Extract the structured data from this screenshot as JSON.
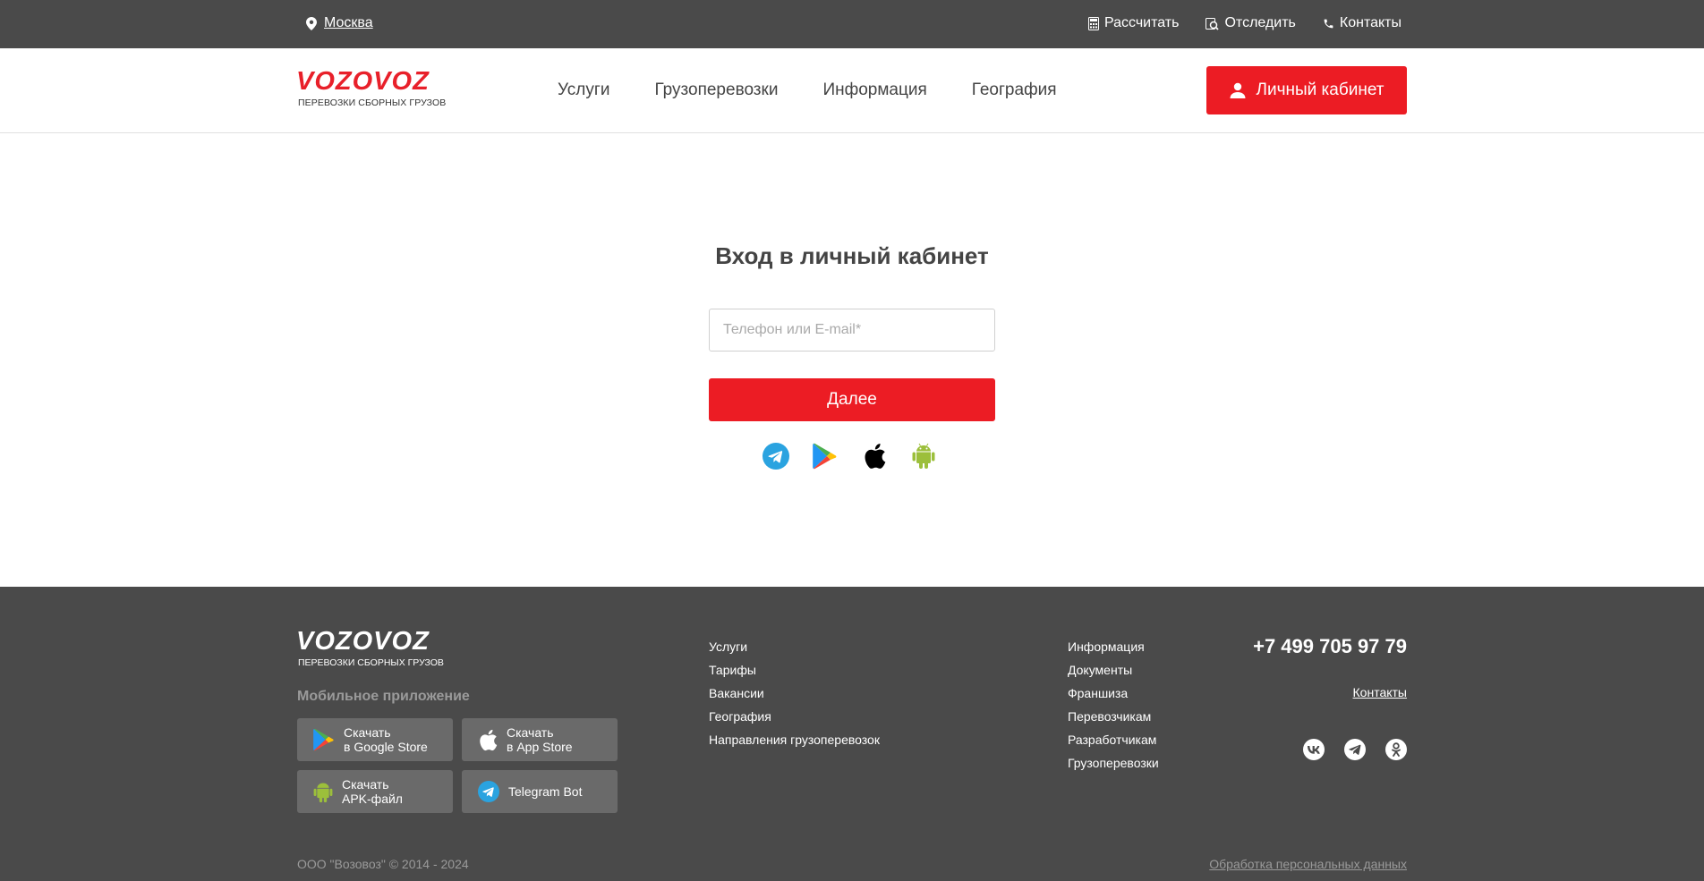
{
  "topbar": {
    "city": "Москва",
    "links": [
      {
        "label": "Рассчитать",
        "icon": "calculator-icon"
      },
      {
        "label": "Отследить",
        "icon": "track-icon"
      },
      {
        "label": "Контакты",
        "icon": "phone-icon"
      }
    ]
  },
  "header": {
    "brand": "VOZOVOZ",
    "tagline": "ПЕРЕВОЗКИ СБОРНЫХ ГРУЗОВ",
    "nav": [
      "Услуги",
      "Грузоперевозки",
      "Информация",
      "География"
    ],
    "cabinet_label": "Личный кабинет"
  },
  "login": {
    "title": "Вход в личный кабинет",
    "input_placeholder": "Телефон или E-mail*",
    "input_value": "",
    "next_label": "Далее",
    "apps": [
      "telegram-icon",
      "google-play-icon",
      "apple-icon",
      "android-icon"
    ]
  },
  "footer": {
    "brand": "VOZOVOZ",
    "tagline": "ПЕРЕВОЗКИ СБОРНЫХ ГРУЗОВ",
    "mobile_title": "Мобильное приложение",
    "stores": [
      {
        "line1": "Скачать",
        "line2": "в Google Store",
        "icon": "google-play-icon"
      },
      {
        "line1": "Скачать",
        "line2": "в App Store",
        "icon": "apple-icon"
      },
      {
        "line1": "Скачать",
        "line2": "APK-файл",
        "icon": "android-icon"
      },
      {
        "line1": "Telegram Bot",
        "line2": "",
        "icon": "telegram-icon"
      }
    ],
    "col1": [
      "Услуги",
      "Тарифы",
      "Вакансии",
      "География",
      "Направления грузоперевозок"
    ],
    "col2": [
      "Информация",
      "Документы",
      "Франшиза",
      "Перевозчикам",
      "Разработчикам",
      "Грузоперевозки"
    ],
    "phone": "+7 499 705 97 79",
    "contacts": "Контакты",
    "social": [
      "vk-icon",
      "telegram-icon",
      "odnoklassniki-icon"
    ],
    "copyright": "ООО \"Возовоз\" © 2014 - 2024",
    "privacy": "Обработка персональных данных"
  },
  "colors": {
    "brand_red": "#ec1c24",
    "dark_bar": "#4a4a4a",
    "telegram": "#2aa3e0",
    "android": "#9cbf3b"
  }
}
